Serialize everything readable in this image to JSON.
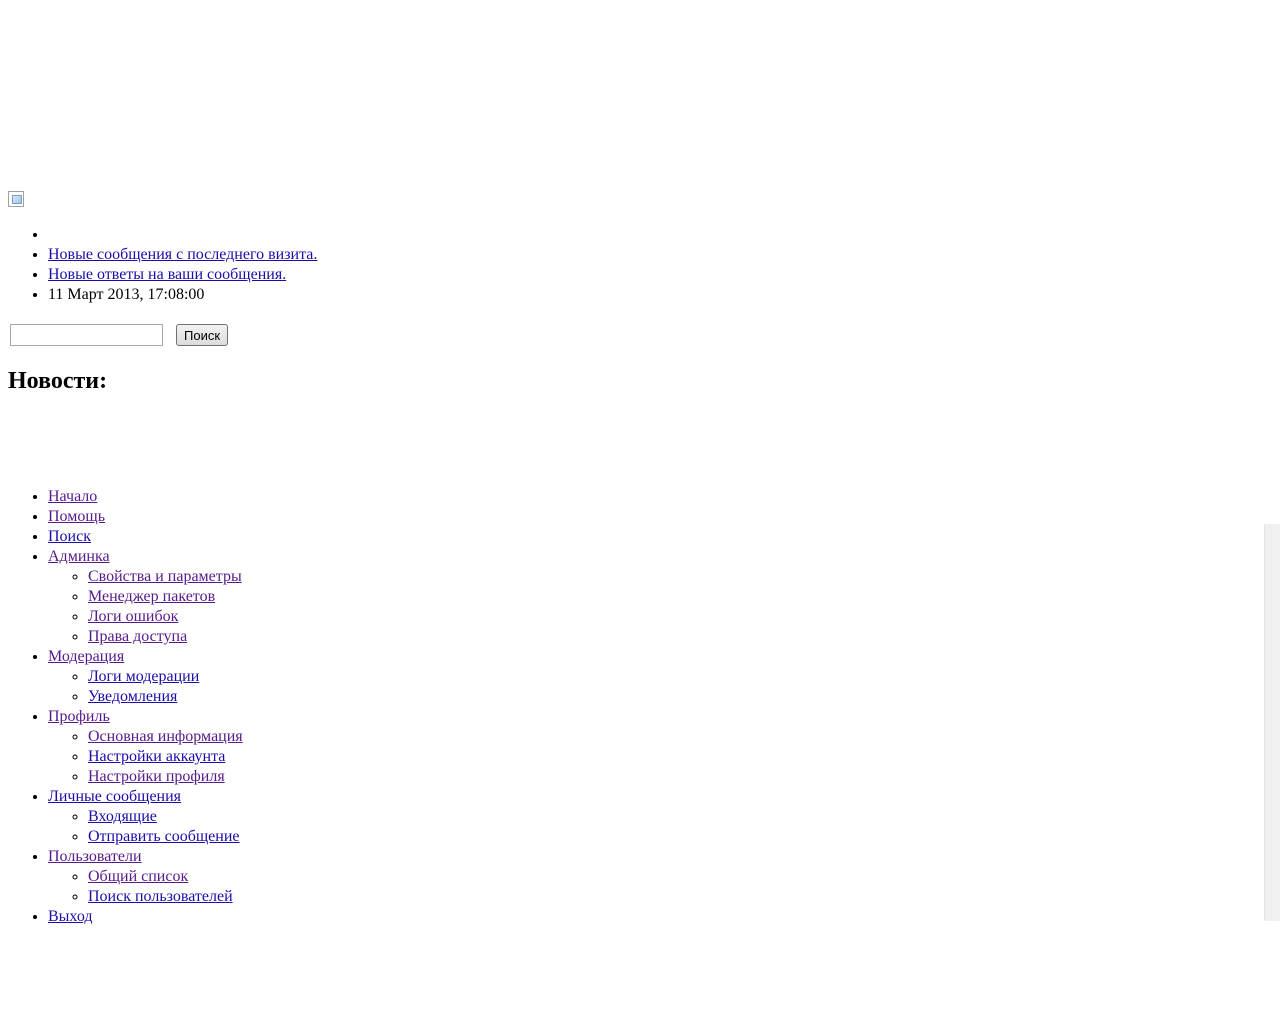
{
  "header": {
    "logo_icon": "broken-image-icon"
  },
  "user_links": {
    "item_1": "",
    "new_posts": "Новые сообщения с последнего визита.",
    "new_replies": "Новые ответы на ваши сообщения.",
    "datetime": "11 Март 2013, 17:08:00"
  },
  "search": {
    "input_value": "",
    "button_label": "Поиск"
  },
  "news": {
    "heading": "Новости:"
  },
  "menu": {
    "home": "Начало",
    "help": "Помощь",
    "search": "Поиск",
    "admin": {
      "label": "Админка",
      "items": [
        "Свойства и параметры",
        "Менеджер пакетов",
        "Логи ошибок",
        "Права доступа"
      ]
    },
    "moderation": {
      "label": "Модерация",
      "items": [
        "Логи модерации",
        "Уведомления"
      ]
    },
    "profile": {
      "label": "Профиль",
      "items": [
        "Основная информация",
        "Настройки аккаунта",
        "Настройки профиля"
      ]
    },
    "pm": {
      "label": "Личные сообщения",
      "items": [
        "Входящие",
        "Отправить сообщение"
      ]
    },
    "members": {
      "label": "Пользователи",
      "items": [
        "Общий список",
        "Поиск пользователей"
      ]
    },
    "logout": "Выход"
  },
  "colors": {
    "link": "#1a0dab",
    "visited_link": "#551a8b",
    "background": "#ffffff"
  }
}
